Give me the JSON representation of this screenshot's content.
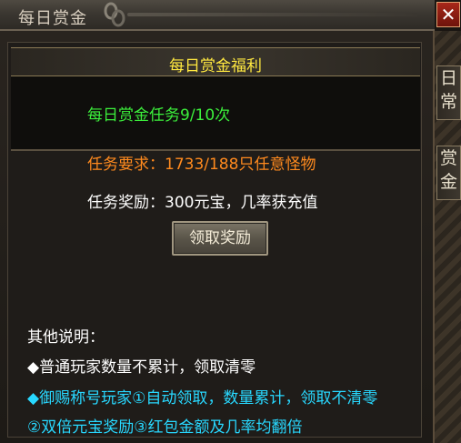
{
  "window": {
    "title": "每日赏金",
    "close_label": "✕"
  },
  "side_tabs": [
    {
      "chars": [
        "日",
        "常"
      ]
    },
    {
      "chars": [
        "赏",
        "金"
      ]
    }
  ],
  "panel": {
    "header": "每日赏金福利",
    "task_count": "每日赏金任务9/10次",
    "requirement": "任务要求：1733/188只任意怪物",
    "reward": "任务奖励：300元宝，几率获充值",
    "claim_button": "领取奖励"
  },
  "notes": {
    "title": "其他说明：",
    "lines": [
      "◆普通玩家数量不累计，领取清零",
      "◆御赐称号玩家①自动领取，数量累计，领取不清零",
      "②双倍元宝奖励③红包金额及几率均翻倍"
    ]
  },
  "colors": {
    "header_text": "#ffe840",
    "task_count": "#3cf03c",
    "requirement": "#ff8a1e",
    "reward": "#ffffff",
    "vip_note": "#28d8ff"
  }
}
